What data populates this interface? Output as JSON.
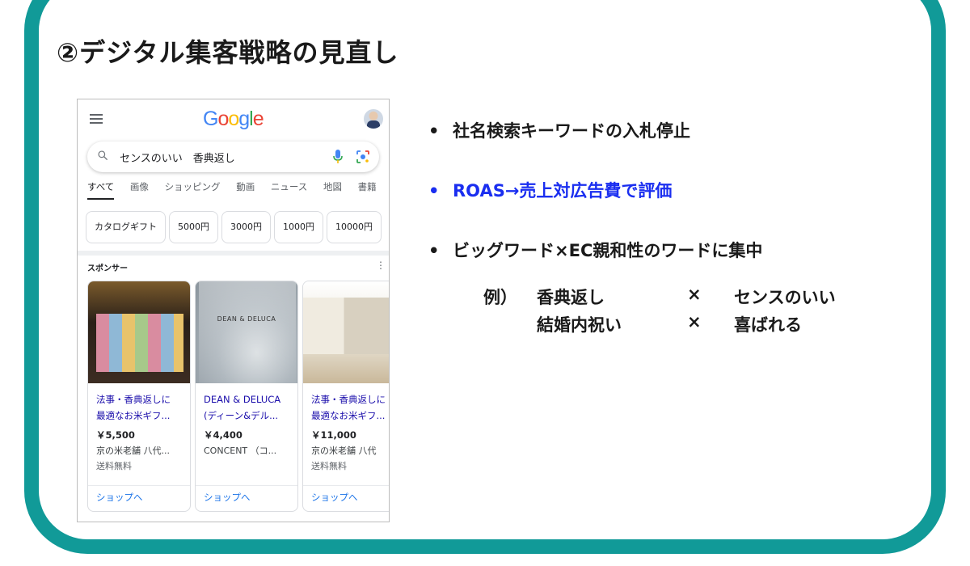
{
  "slide": {
    "title": "②デジタル集客戦略の見直し",
    "accent_color": "#119a98"
  },
  "phone": {
    "logo": "Google",
    "search": {
      "query": "センスのいい　香典返し",
      "icons": [
        "search-icon",
        "mic-icon",
        "lens-icon"
      ]
    },
    "tabs": [
      "すべて",
      "画像",
      "ショッピング",
      "動画",
      "ニュース",
      "地図",
      "書籍"
    ],
    "chips": [
      "カタログギフト",
      "5000円",
      "3000円",
      "1000円",
      "10000円"
    ],
    "sponsor_label": "スポンサー",
    "more_icon": "⋮",
    "products": [
      {
        "title1": "法事・香典返しに",
        "title2": "最適なお米ギフ...",
        "price": "￥5,500",
        "seller": "京の米老舗 八代...",
        "shipping": "送料無料",
        "shop": "ショップへ"
      },
      {
        "title1": "DEAN & DELUCA",
        "title2": "(ディーン&デル...",
        "price": "￥4,400",
        "seller": "CONCENT （コ...",
        "shipping": "",
        "shop": "ショップへ",
        "image_text": "DEAN & DELUCA"
      },
      {
        "title1": "法事・香典返しに",
        "title2": "最適なお米ギフ...",
        "price": "￥11,000",
        "seller": "京の米老舗 八代",
        "shipping": "送料無料",
        "shop": "ショップへ"
      }
    ]
  },
  "bullets": [
    {
      "text": "社名検索キーワードの入札停止",
      "color": "#1a1a1a"
    },
    {
      "text": "ROAS→売上対広告費で評価",
      "color": "#1a2ef0"
    },
    {
      "text": "ビッグワード×EC親和性のワードに集中",
      "color": "#1a1a1a"
    }
  ],
  "example": {
    "prefix": "例）",
    "rows": [
      {
        "a": "香典返し",
        "x": "×",
        "b": "センスのいい"
      },
      {
        "a": "結婚内祝い",
        "x": "×",
        "b": "喜ばれる"
      }
    ]
  }
}
